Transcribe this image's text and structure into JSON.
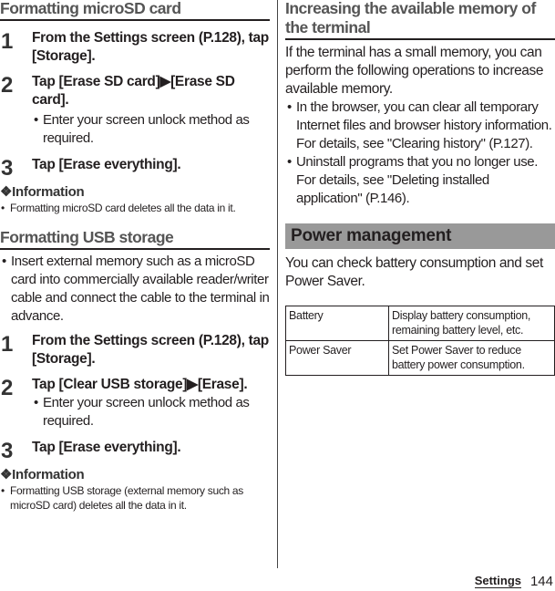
{
  "left": {
    "sections": [
      {
        "title": "Formatting microSD card",
        "steps": [
          {
            "num": "1",
            "text": "From the Settings screen (P.128), tap [Storage]."
          },
          {
            "num": "2",
            "text": "Tap [Erase SD card]▶[Erase SD card].",
            "note": "Enter your screen unlock method as required."
          },
          {
            "num": "3",
            "text": "Tap [Erase everything]."
          }
        ],
        "info_title": "❖Information",
        "info_items": [
          "Formatting microSD card deletes all the data in it."
        ]
      },
      {
        "title": "Formatting USB storage",
        "bullets": [
          "Insert external memory such as a microSD card into commercially available reader/writer cable and connect the cable to the terminal in advance."
        ],
        "steps": [
          {
            "num": "1",
            "text": "From the Settings screen (P.128), tap [Storage]."
          },
          {
            "num": "2",
            "text": "Tap [Clear USB storage]▶[Erase].",
            "note": "Enter your screen unlock method as required."
          },
          {
            "num": "3",
            "text": "Tap [Erase everything]."
          }
        ],
        "info_title": "❖Information",
        "info_items": [
          "Formatting USB storage (external memory such as microSD card) deletes all the data in it."
        ]
      }
    ]
  },
  "right": {
    "memory": {
      "title": "Increasing the available memory of the terminal",
      "intro": "If the terminal has a small memory, you can perform the following operations to increase available memory.",
      "bullets": [
        "In the browser, you can clear all temporary Internet files and browser history information. For details, see \"Clearing history\" (P.127).",
        "Uninstall programs that you no longer use. For details, see \"Deleting installed application\" (P.146)."
      ]
    },
    "power": {
      "band_title": "Power management",
      "intro": "You can check battery consumption and set Power Saver.",
      "table": [
        {
          "key": "Battery",
          "value": "Display battery consumption, remaining battery level, etc."
        },
        {
          "key": "Power Saver",
          "value": "Set Power Saver to reduce battery power consumption."
        }
      ]
    }
  },
  "footer": {
    "section_label": "Settings",
    "page_number": "144"
  },
  "bullet_char": "•"
}
